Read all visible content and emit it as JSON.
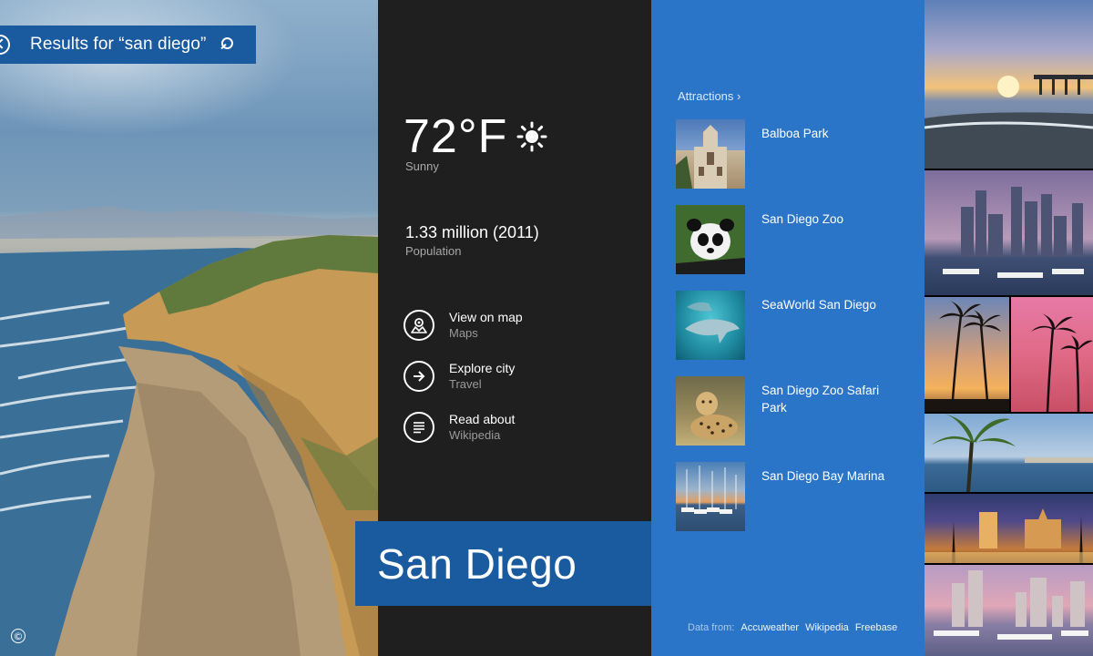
{
  "search": {
    "query_label": "Results for “san diego”"
  },
  "weather": {
    "temperature": "72°F",
    "condition": "Sunny",
    "icon": "sun-icon"
  },
  "population": {
    "value": "1.33 million (2011)",
    "label": "Population"
  },
  "actions": [
    {
      "title": "View on map",
      "subtitle": "Maps",
      "icon": "map-pin-icon"
    },
    {
      "title": "Explore city",
      "subtitle": "Travel",
      "icon": "arrow-right-icon"
    },
    {
      "title": "Read about",
      "subtitle": "Wikipedia",
      "icon": "article-icon"
    }
  ],
  "city": {
    "name": "San Diego"
  },
  "attractions": {
    "header": "Attractions ›",
    "items": [
      {
        "name": "Balboa Park"
      },
      {
        "name": "San Diego Zoo"
      },
      {
        "name": "SeaWorld San Diego"
      },
      {
        "name": "San Diego Zoo Safari Park"
      },
      {
        "name": "San Diego Bay Marina"
      }
    ]
  },
  "footer": {
    "data_from_label": "Data from:",
    "sources": [
      "Accuweather",
      "Wikipedia",
      "Freebase"
    ]
  },
  "copyright_symbol": "©",
  "colors": {
    "accent_blue": "#1a5a9e",
    "attractions_blue": "#2b75c8",
    "dark_panel": "#1f1f1f"
  }
}
